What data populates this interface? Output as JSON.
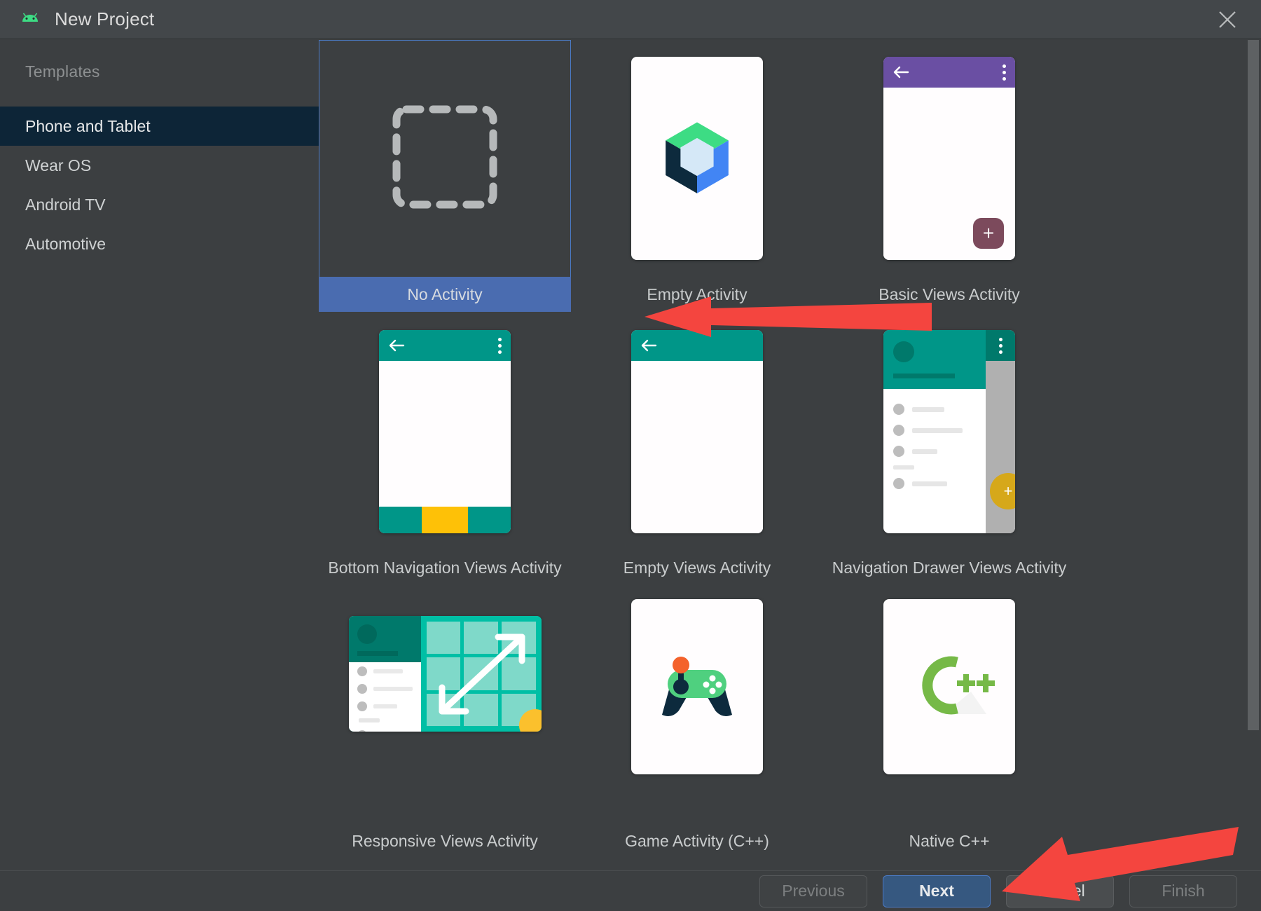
{
  "window": {
    "title": "New Project",
    "app_icon": "android-icon",
    "close_icon": "close-icon"
  },
  "sidebar": {
    "header": "Templates",
    "items": [
      {
        "label": "Phone and Tablet",
        "selected": true
      },
      {
        "label": "Wear OS",
        "selected": false
      },
      {
        "label": "Android TV",
        "selected": false
      },
      {
        "label": "Automotive",
        "selected": false
      }
    ]
  },
  "templates": [
    {
      "label": "No Activity",
      "selected": true,
      "thumb": "dashed-placeholder-icon"
    },
    {
      "label": "Empty Activity",
      "selected": false,
      "thumb": "jetpack-compose-logo"
    },
    {
      "label": "Basic Views Activity",
      "selected": false,
      "thumb": "phone-purple-appbar-fab"
    },
    {
      "label": "Bottom Navigation Views Activity",
      "selected": false,
      "thumb": "phone-teal-bottom-nav"
    },
    {
      "label": "Empty Views Activity",
      "selected": false,
      "thumb": "phone-teal-empty"
    },
    {
      "label": "Navigation Drawer Views Activity",
      "selected": false,
      "thumb": "phone-navigation-drawer"
    },
    {
      "label": "Responsive Views Activity",
      "selected": false,
      "thumb": "responsive-grid"
    },
    {
      "label": "Game Activity (C++)",
      "selected": false,
      "thumb": "game-controller-icon"
    },
    {
      "label": "Native C++",
      "selected": false,
      "thumb": "cpp-logo"
    }
  ],
  "buttons": {
    "previous": {
      "label": "Previous",
      "enabled": false,
      "default": false
    },
    "next": {
      "label": "Next",
      "enabled": true,
      "default": true
    },
    "cancel": {
      "label": "Cancel",
      "enabled": true,
      "default": false
    },
    "finish": {
      "label": "Finish",
      "enabled": false,
      "default": false
    }
  },
  "annotations": [
    {
      "name": "arrow-to-no-activity",
      "color": "#f4453f",
      "points_to": "No Activity"
    },
    {
      "name": "arrow-to-cancel",
      "color": "#f4453f",
      "points_to": "Cancel"
    }
  ],
  "colors": {
    "window_bg": "#3c3f41",
    "titlebar_bg": "#43474a",
    "sidebar_selected": "#0d2537",
    "selection_blue": "#4a6cb0",
    "focus_border": "#4b7ac4",
    "default_button": "#365880",
    "annotation_red": "#f4453f",
    "android_green": "#3ddc84",
    "material_purple": "#6a4fa3",
    "material_teal": "#009688",
    "material_amber": "#fec107",
    "cpp_green": "#76b947"
  },
  "scrollbar": {
    "name": "vertical-scrollbar",
    "thumb_position_percent": 0
  }
}
